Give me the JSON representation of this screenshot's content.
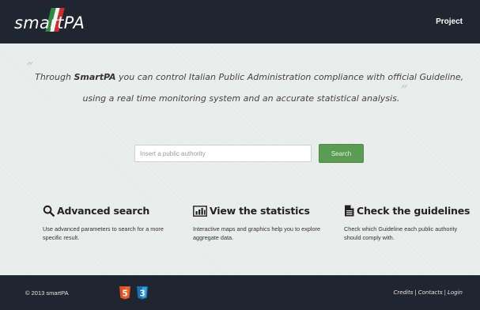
{
  "header": {
    "logo_text": "smartPA",
    "nav_project": "Project"
  },
  "hero": {
    "quote_before": "Through ",
    "quote_brand": "SmartPA",
    "quote_after": " you can control Italian Public Administration compliance with official Guideline, using a real time monitoring system and an accurate statistical analysis."
  },
  "search": {
    "placeholder": "Insert a public authority",
    "value": "",
    "button_label": "Search"
  },
  "features": [
    {
      "icon": "search-icon",
      "title": "Advanced search",
      "description": "Use advanced parameters to search for a more specific result."
    },
    {
      "icon": "bar-chart-icon",
      "title": "View the statistics",
      "description": "Interactive maps and graphics help you to explore aggregate data."
    },
    {
      "icon": "document-icon",
      "title": "Check the guidelines",
      "description": "Check which Guideline each public authority should comply with."
    }
  ],
  "footer": {
    "copyright": "© 2013 smartPA",
    "html5_badge": "5",
    "css3_badge": "3",
    "links": [
      "Credits",
      "Contacts",
      "Login"
    ],
    "separator": "|"
  },
  "colors": {
    "navbar": "#1f2630",
    "background": "#eceeed",
    "search_button": "#5a9c52",
    "html5": "#e44d26",
    "css3": "#2965f1"
  }
}
